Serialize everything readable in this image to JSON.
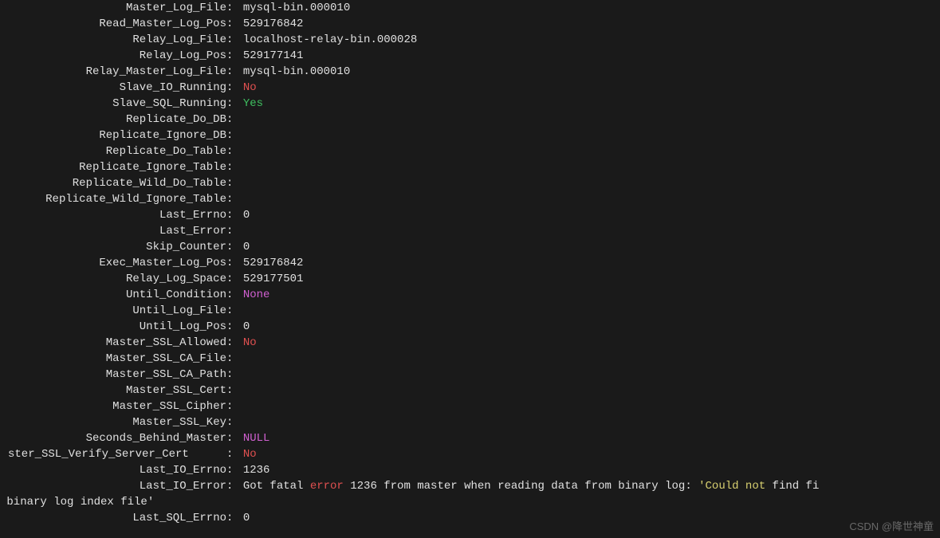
{
  "rows": [
    {
      "label": "Master_Log_File",
      "value": "mysql-bin.000010",
      "cls": ""
    },
    {
      "label": "Read_Master_Log_Pos",
      "value": "529176842",
      "cls": ""
    },
    {
      "label": "Relay_Log_File",
      "value": "localhost-relay-bin.000028",
      "cls": ""
    },
    {
      "label": "Relay_Log_Pos",
      "value": "529177141",
      "cls": ""
    },
    {
      "label": "Relay_Master_Log_File",
      "value": "mysql-bin.000010",
      "cls": ""
    },
    {
      "label": "Slave_IO_Running",
      "value": "No",
      "cls": "c-red"
    },
    {
      "label": "Slave_SQL_Running",
      "value": "Yes",
      "cls": "c-green"
    },
    {
      "label": "Replicate_Do_DB",
      "value": "",
      "cls": ""
    },
    {
      "label": "Replicate_Ignore_DB",
      "value": "",
      "cls": ""
    },
    {
      "label": "Replicate_Do_Table",
      "value": "",
      "cls": ""
    },
    {
      "label": "Replicate_Ignore_Table",
      "value": "",
      "cls": ""
    },
    {
      "label": "Replicate_Wild_Do_Table",
      "value": "",
      "cls": ""
    },
    {
      "label": "Replicate_Wild_Ignore_Table",
      "value": "",
      "cls": ""
    },
    {
      "label": "Last_Errno",
      "value": "0",
      "cls": ""
    },
    {
      "label": "Last_Error",
      "value": "",
      "cls": ""
    },
    {
      "label": "Skip_Counter",
      "value": "0",
      "cls": ""
    },
    {
      "label": "Exec_Master_Log_Pos",
      "value": "529176842",
      "cls": ""
    },
    {
      "label": "Relay_Log_Space",
      "value": "529177501",
      "cls": ""
    },
    {
      "label": "Until_Condition",
      "value": "None",
      "cls": "c-magenta"
    },
    {
      "label": "Until_Log_File",
      "value": "",
      "cls": ""
    },
    {
      "label": "Until_Log_Pos",
      "value": "0",
      "cls": ""
    },
    {
      "label": "Master_SSL_Allowed",
      "value": "No",
      "cls": "c-red"
    },
    {
      "label": "Master_SSL_CA_File",
      "value": "",
      "cls": ""
    },
    {
      "label": "Master_SSL_CA_Path",
      "value": "",
      "cls": ""
    },
    {
      "label": "Master_SSL_Cert",
      "value": "",
      "cls": ""
    },
    {
      "label": "Master_SSL_Cipher",
      "value": "",
      "cls": ""
    },
    {
      "label": "Master_SSL_Key",
      "value": "",
      "cls": ""
    },
    {
      "label": "Seconds_Behind_Master",
      "value": "NULL",
      "cls": "c-magenta"
    },
    {
      "label": "ster_SSL_Verify_Server_Cert",
      "value": "No",
      "cls": "c-red",
      "truncated": true
    },
    {
      "label": "Last_IO_Errno",
      "value": "1236",
      "cls": ""
    }
  ],
  "last_io_error": {
    "label": "Last_IO_Error",
    "parts": [
      {
        "t": "Got fatal ",
        "cls": ""
      },
      {
        "t": "error",
        "cls": "c-red"
      },
      {
        "t": " 1236 from master when reading data from binary log: ",
        "cls": ""
      },
      {
        "t": "'Could not",
        "cls": "c-yellow"
      },
      {
        "t": " find fi",
        "cls": ""
      }
    ],
    "wrap": " binary log index file'"
  },
  "tail_rows": [
    {
      "label": "Last_SQL_Errno",
      "value": "0",
      "cls": ""
    }
  ],
  "watermark": "CSDN @降世神童"
}
